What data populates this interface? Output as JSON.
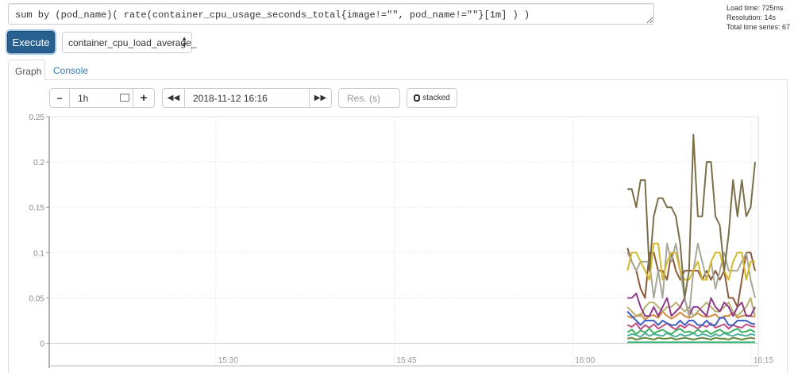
{
  "query": {
    "value": "sum by (pod_name)( rate(container_cpu_usage_seconds_total{image!=\"\", pod_name!=\"\"}[1m] ) )"
  },
  "stats": {
    "load_time": "Load time: 725ms",
    "resolution": "Resolution: 14s",
    "total_series": "Total time series: 67"
  },
  "execute_label": "Execute",
  "metric_select": "container_cpu_load_average_",
  "tabs": [
    {
      "label": "Graph",
      "active": true
    },
    {
      "label": "Console",
      "active": false
    }
  ],
  "controls": {
    "range": "1h",
    "end_time": "2018-11-12 16:16",
    "res_placeholder": "Res. (s)",
    "stacked_label": "stacked"
  },
  "icons": {
    "minus": "minus-icon",
    "plus": "plus-icon",
    "calendar": "calendar-icon",
    "back": "fast-backward-icon",
    "forward": "fast-forward-icon"
  },
  "chart_data": {
    "type": "line",
    "title": "",
    "xlabel": "",
    "ylabel": "",
    "x_ticks": [
      "15:30",
      "15:45",
      "16:00",
      "16:15"
    ],
    "x_range_minutes_after_1500": [
      16,
      75.6
    ],
    "x_tick_minutes": [
      30,
      45,
      60,
      75
    ],
    "series_start_minutes": 64.6,
    "series_step_minutes": 0.37,
    "y_ticks": [
      "0",
      "0.05",
      "0.1",
      "0.15",
      "0.2",
      "0.25"
    ],
    "y_tick_values": [
      0,
      0.05,
      0.1,
      0.15,
      0.2,
      0.25
    ],
    "ylim": [
      -0.025,
      0.25
    ],
    "grid": true,
    "series": [
      {
        "color": "#7b6f48",
        "values": [
          0.17,
          0.17,
          0.15,
          0.18,
          0.18,
          0.08,
          0.14,
          0.16,
          0.16,
          0.15,
          0.15,
          0.14,
          0.11,
          0.05,
          0.08,
          0.23,
          0.14,
          0.14,
          0.2,
          0.2,
          0.14,
          0.13,
          0.08,
          0.12,
          0.18,
          0.14,
          0.18,
          0.14,
          0.15,
          0.2
        ]
      },
      {
        "color": "#d4b92a",
        "values": [
          0.08,
          0.1,
          0.1,
          0.09,
          0.08,
          0.07,
          0.11,
          0.11,
          0.07,
          0.09,
          0.1,
          0.1,
          0.08,
          0.07,
          0.07,
          0.08,
          0.09,
          0.07,
          0.07,
          0.09,
          0.1,
          0.1,
          0.08,
          0.07,
          0.09,
          0.1,
          0.1,
          0.07,
          0.09,
          0.09
        ]
      },
      {
        "color": "#a8a898",
        "values": [
          0.1,
          0.09,
          0.08,
          0.09,
          0.09,
          0.09,
          0.05,
          0.08,
          0.05,
          0.11,
          0.09,
          0.11,
          0.08,
          0.05,
          0.03,
          0.08,
          0.11,
          0.09,
          0.07,
          0.09,
          0.06,
          0.08,
          0.1,
          0.08,
          0.08,
          0.08,
          0.09,
          0.1,
          0.07,
          0.05
        ]
      },
      {
        "color": "#8a5a3a",
        "values": [
          0.105,
          0.09,
          0.08,
          0.06,
          0.05,
          0.1,
          0.1,
          0.08,
          0.08,
          0.07,
          0.1,
          0.08,
          0.07,
          0.08,
          0.08,
          0.08,
          0.08,
          0.07,
          0.08,
          0.07,
          0.08,
          0.07,
          0.08,
          0.05,
          0.05,
          0.04,
          0.07,
          0.1,
          0.1,
          0.08
        ]
      },
      {
        "color": "#8e3a8a",
        "values": [
          0.05,
          0.05,
          0.055,
          0.04,
          0.03,
          0.03,
          0.04,
          0.03,
          0.04,
          0.05,
          0.03,
          0.035,
          0.04,
          0.05,
          0.03,
          0.04,
          0.04,
          0.035,
          0.03,
          0.05,
          0.04,
          0.035,
          0.045,
          0.04,
          0.03,
          0.04,
          0.045,
          0.03,
          0.03,
          0.04
        ]
      },
      {
        "color": "#b8b070",
        "values": [
          0.04,
          0.035,
          0.03,
          0.03,
          0.04,
          0.045,
          0.045,
          0.04,
          0.035,
          0.04,
          0.04,
          0.045,
          0.04,
          0.035,
          0.04,
          0.03,
          0.035,
          0.04,
          0.045,
          0.04,
          0.035,
          0.035,
          0.04,
          0.045,
          0.035,
          0.03,
          0.035,
          0.04,
          0.05,
          0.03
        ]
      },
      {
        "color": "#3a5fc0",
        "values": [
          0.035,
          0.03,
          0.025,
          0.02,
          0.025,
          0.025,
          0.025,
          0.02,
          0.025,
          0.022,
          0.02,
          0.02,
          0.025,
          0.02,
          0.025,
          0.025,
          0.02,
          0.02,
          0.025,
          0.02,
          0.02,
          0.028,
          0.028,
          0.02,
          0.02,
          0.025,
          0.025,
          0.025,
          0.022,
          0.021
        ]
      },
      {
        "color": "#d08a40",
        "values": [
          0.03,
          0.028,
          0.03,
          0.032,
          0.026,
          0.03,
          0.031,
          0.028,
          0.035,
          0.03,
          0.027,
          0.03,
          0.034,
          0.03,
          0.028,
          0.03,
          0.033,
          0.03,
          0.029,
          0.03,
          0.032,
          0.027,
          0.03,
          0.03,
          0.034,
          0.028,
          0.03,
          0.031,
          0.03,
          0.029
        ]
      },
      {
        "color": "#40b060",
        "values": [
          0.012,
          0.015,
          0.01,
          0.014,
          0.012,
          0.016,
          0.011,
          0.013,
          0.015,
          0.012,
          0.01,
          0.014,
          0.016,
          0.012,
          0.013,
          0.011,
          0.015,
          0.012,
          0.014,
          0.01,
          0.013,
          0.015,
          0.012,
          0.011,
          0.014,
          0.016,
          0.012,
          0.013,
          0.015,
          0.012
        ]
      },
      {
        "color": "#50b0a0",
        "values": [
          0.008,
          0.01,
          0.009,
          0.007,
          0.011,
          0.008,
          0.01,
          0.009,
          0.008,
          0.011,
          0.009,
          0.007,
          0.01,
          0.008,
          0.009,
          0.011,
          0.008,
          0.01,
          0.009,
          0.007,
          0.01,
          0.008,
          0.011,
          0.009,
          0.008,
          0.01,
          0.009,
          0.008,
          0.01,
          0.009
        ]
      },
      {
        "color": "#c05080",
        "values": [
          0.02,
          0.018,
          0.022,
          0.015,
          0.02,
          0.017,
          0.021,
          0.016,
          0.019,
          0.022,
          0.018,
          0.015,
          0.02,
          0.017,
          0.021,
          0.019,
          0.016,
          0.02,
          0.018,
          0.022,
          0.017,
          0.019,
          0.021,
          0.016,
          0.02,
          0.018,
          0.017,
          0.021,
          0.019,
          0.018
        ]
      },
      {
        "color": "#6a8a40",
        "values": [
          0.005,
          0.006,
          0.004,
          0.005,
          0.006,
          0.005,
          0.004,
          0.006,
          0.005,
          0.005,
          0.006,
          0.004,
          0.005,
          0.006,
          0.005,
          0.004,
          0.005,
          0.006,
          0.005,
          0.004,
          0.006,
          0.005,
          0.005,
          0.004,
          0.006,
          0.005,
          0.004,
          0.005,
          0.006,
          0.005
        ]
      },
      {
        "color": "#3cb878",
        "values": [
          0.001,
          0.001,
          0.001,
          0.001,
          0.001,
          0.001,
          0.001,
          0.001,
          0.001,
          0.001,
          0.001,
          0.001,
          0.001,
          0.001,
          0.001,
          0.001,
          0.001,
          0.001,
          0.001,
          0.001,
          0.001,
          0.001,
          0.001,
          0.001,
          0.001,
          0.001,
          0.001,
          0.001,
          0.001,
          0.001
        ]
      }
    ]
  }
}
